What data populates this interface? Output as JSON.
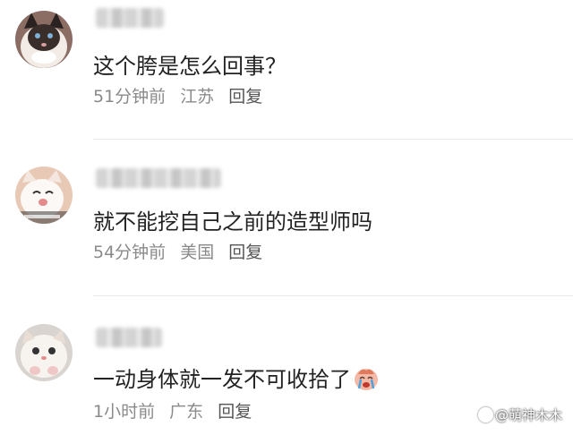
{
  "comments": [
    {
      "text": "这个胯是怎么回事？",
      "time": "51分钟前",
      "location": "江苏",
      "reply_label": "回复",
      "avatar": "cat-avatar-siamese"
    },
    {
      "text": "就不能挖自己之前的造型师吗",
      "time": "54分钟前",
      "location": "美国",
      "reply_label": "回复",
      "avatar": "cat-avatar-white"
    },
    {
      "text": "一动身体就一发不可收拾了",
      "time": "1小时前",
      "location": "广东",
      "reply_label": "回复",
      "avatar": "cat-avatar-kitten",
      "trailing_icon": "crying-face-emoji"
    }
  ],
  "watermark": "@萌神木木"
}
